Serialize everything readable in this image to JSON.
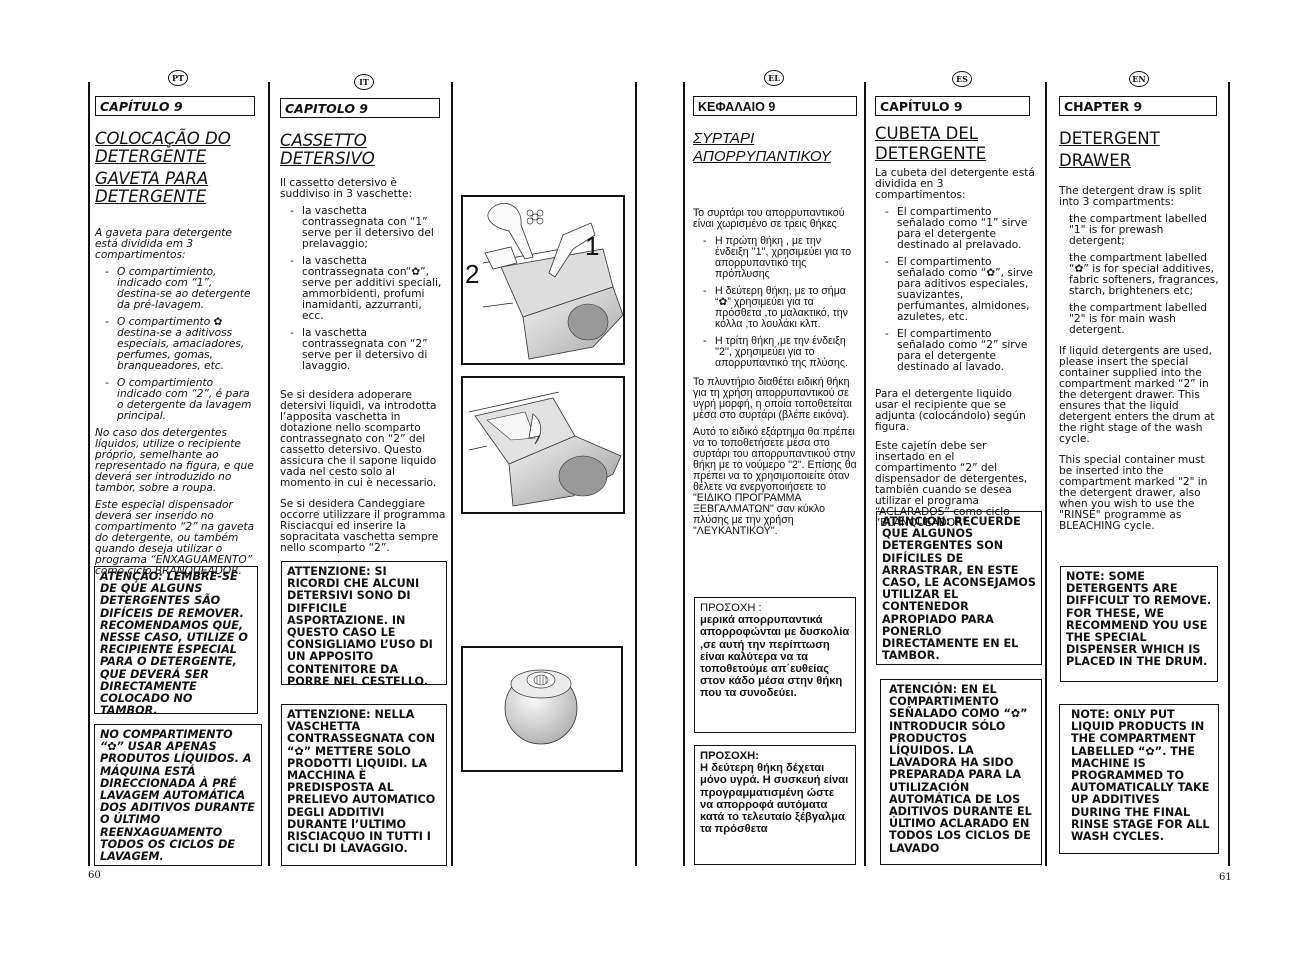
{
  "page_numbers": {
    "left": "60",
    "right": "61"
  },
  "pt": {
    "lang": "PT",
    "chapter": "CAPÍTULO 9",
    "title1": "COLOCAÇÃO DO DETERGENTE",
    "title2": "GAVETA PARA DETERGENTE",
    "intro": "A gaveta para detergente está dividida em 3 compartimentos:",
    "items": [
      "O compartimiento, indicado com “1”, destina-se ao detergente da pré-lavagem.",
      "O compartimento ✿ destina-se a aditivoss especiais, amaciadores, perfumes, gomas, branqueadores, etc.",
      "O compartimiento indicado com “2”, é para o detergente da lavagem principal."
    ],
    "para1": "No caso dos detergentes líquidos, utilize o recipiente próprio, semelhante ao representado na figura, e que deverá ser introduzido no tambor, sobre a roupa.",
    "para2": "Este especial dispensador deverá ser inserido no compartimento “2” na gaveta do detergente, ou também quando deseja utilizar o programa “ENXAGUAMENTO” como ciclo BRANQUEADOR.",
    "box1": "ATENÇÃO: LEMBRE-SE DE QUE ALGUNS DETERGENTES SÃO DIFÍCEIS DE REMOVER. RECOMENDAMOS QUE, NESSE CASO, UTILIZE O RECIPIENTE ESPECIAL PARA O DETERGENTE, QUE DEVERÁ SER DIRECTAMENTE COLOCADO NO TAMBOR.",
    "box2": "NO COMPARTIMENTO “✿” USAR APENAS PRODUTOS LÍQUIDOS. A MÁQUINA ESTÁ DIRECCIONADA À PRÉ LAVAGEM AUTOMÁTICA DOS ADITIVOS DURANTE O ÚLTIMO REENXAGUAMENTO TODOS OS CICLOS DE LAVAGEM."
  },
  "it": {
    "lang": "IT",
    "chapter": "CAPITOLO 9",
    "title": "CASSETTO DETERSIVO",
    "intro": "Il cassetto detersivo è suddiviso in 3 vaschette:",
    "items": [
      "la vaschetta contrassegnata con “1” serve per il detersivo del prelavaggio;",
      "la vaschetta contrassegnata con“✿”, serve per additivi speciali, ammorbidenti, profumi inamidanti, azzurranti, ecc.",
      "la vaschetta contrassegnata con “2” serve per il detersivo di lavaggio."
    ],
    "para1": "Se si desidera adoperare detersivi liquidi, va introdotta l’apposita vaschetta in dotazione nello scomparto contrassegnato con “2” del cassetto detersivo. Questo assicura che il sapone liquido vada nel cesto solo al momento in cui è necessario.",
    "para2": "Se si desidera Candeggiare occorre utilizzare il programma Risciacqui ed inserire la sopracitata vaschetta sempre nello scomparto “2”.",
    "box1": "ATTENZIONE: SI RICORDI CHE ALCUNI DETERSIVI SONO DI DIFFICILE ASPORTAZIONE. IN QUESTO CASO LE CONSIGLIAMO L’USO DI UN APPOSITO CONTENITORE DA PORRE NEL CESTELLO.",
    "box2": "ATTENZIONE: NELLA VASCHETTA CONTRASSEGNATA CON “✿” METTERE SOLO PRODOTTI LIQUIDI. LA MACCHINA È PREDISPOSTA AL PRELIEVO AUTOMATICO DEGLI ADDITIVI DURANTE l’ULTIMO RISCIACQUO IN TUTTI I CICLI DI LAVAGGIO."
  },
  "figures": {
    "fig1_label_1": "1",
    "fig1_label_2": "2",
    "fig1_desc": "Detergent drawer with compartments 1, 2 and additive",
    "fig2_desc": "Liquid detergent container inserted in compartment 2",
    "fig3_desc": "Dosing ball for the drum"
  },
  "el": {
    "lang": "EL",
    "chapter": "ΚΕΦΑΛΑΙΟ 9",
    "title": "ΣΥΡΤΑΡΙ ΑΠΟΡΡΥΠΑΝΤΙΚΟΥ",
    "intro": "Το συρτάρι του απορρυπαντικού είναι χωρισμένο σε τρεις θήκες",
    "items": [
      "Η πρώτη θήκη , με την ένδειξη ''1'', χρησιμεύει για το απορρυπαντικό της πρόπλυσης",
      "Η δεύτερη θήκη, με το σήμα “✿” χρησιμεύει για τα πρόσθετα ,το μαλακτικό, την κόλλα ,το λουλάκι κλπ.",
      "Η τρίτη θήκη ,με την ένδειξη ''2'', χρησιμεύει για το απορρυπαντικό της πλύσης."
    ],
    "para1": "Το πλυντήριο διαθέτει ειδική θήκη για τη χρήση απορρυπαντικού σε υγρή μορφή, η οποία τοποθετείται μέσα στο συρτάρι (βλέπε εικόνα).",
    "para2": "Αυτό το ειδικό εξάρτημα θα πρέπει να το τοποθετήσετε μέσα στο συρτάρι του απορρυπαντικού στην θήκη με το νούμερο \"2\". Επίσης θα πρέπει να το χρησιμοποιείτε όταν θέλετε να ενεργοποιήσετε το \"ΕΙΔΙΚΟ ΠΡΟΓΡΑΜΜΑ ΞΕΒΓΑΛΜΑΤΩΝ\" σαν κύκλο πλύσης με την χρήση \"ΛΕΥΚΑΝΤΙΚΟΥ\".",
    "box1_head": "ΠΡΟΣΟΧΗ :",
    "box1": "μερικά απορρυπαντικά απορροφώνται με δυσκολία ,σε αυτή την περίπτωση είναι καλύτερα να τα τοποθετούμε απ΄ευθείας στον κάδο μέσα στην θήκη που τα συνοδεύει.",
    "box2_head": "ΠΡΟΣΟΧΗ:",
    "box2": "Η δεύτερη θήκη δέχεται μόνο υγρά. Η συσκευή είναι προγραμματισμένη ώστε να απορροφά αυτόματα κατά το τελευταίο ξέβγαλμα τα πρόσθετα"
  },
  "es": {
    "lang": "ES",
    "chapter": "CAPÍTULO 9",
    "title": "CUBETA DEL DETERGENTE",
    "intro": "La cubeta del detergente está dividida en 3 compartimentos:",
    "items": [
      "El compartimento señalado como “1” sirve para el detergente destinado al prelavado.",
      "El compartimento señalado como “✿”, sirve para aditivos especiales, suavizantes, perfumantes, almidones, azuletes, etc.",
      "El compartimento señalado como “2” sirve para el detergente destinado al lavado."
    ],
    "para1": "Para el detergente liquido usar el recipiente que se adjunta (colocándolo) según figura.",
    "para2": "Este cajetín debe ser insertado en el compartimento “2” del dispensador de detergentes, también cuando se desea utilizar el programa “ACLARADOS” como ciclo “BLANQUEADOR”.",
    "box1": "ATENCIÓN: RECUERDE QUE ALGUNOS DETERGENTES SON DIFÍCILES DE ARRASTRAR, EN ESTE CASO, LE ACONSEJAMOS UTILIZAR EL CONTENEDOR APROPIADO PARA PONERLO DIRECTAMENTE EN EL TAMBOR.",
    "box2": "ATENCIÓN: EN EL COMPARTIMENTO SEÑALADO COMO “✿” INTRODUCIR SÓLO PRODUCTOS LÍQUIDOS. LA LAVADORA HA SIDO PREPARADA PARA LA UTILIZACIÓN AUTOMÁTICA DE LOS ADITIVOS DURANTE EL ÚLTIMO ACLARADO EN TODOS LOS CICLOS DE LAVADO"
  },
  "en": {
    "lang": "EN",
    "chapter": "CHAPTER 9",
    "title": "DETERGENT DRAWER",
    "intro": "The detergent draw is split into 3 compartments:",
    "items": [
      "the compartment labelled \"1\" is for prewash detergent;",
      "the compartment labelled “✿” is for special additives, fabric softeners, fragrances, starch, brighteners etc;",
      "the compartment labelled \"2\" is for main wash detergent."
    ],
    "para1": "If liquid detergents are used, please insert the special container supplied into the compartment marked “2” in the detergent drawer. This ensures that the liquid detergent enters the drum at the right stage of the wash cycle.",
    "para2": "This special container must be inserted into the compartment marked \"2\" in the detergent drawer, also when you wish to use the \"RINSE\" programme as BLEACHING cycle.",
    "box1": "NOTE: SOME DETERGENTS ARE DIFFICULT TO REMOVE. FOR THESE, WE RECOMMEND YOU USE THE SPECIAL DISPENSER WHICH IS PLACED IN THE DRUM.",
    "box2": "NOTE: ONLY PUT LIQUID PRODUCTS IN THE COMPARTMENT LABELLED “✿”. THE MACHINE IS PROGRAMMED TO AUTOMATICALLY TAKE UP ADDITIVES DURING THE FINAL RINSE STAGE FOR ALL WASH CYCLES."
  }
}
